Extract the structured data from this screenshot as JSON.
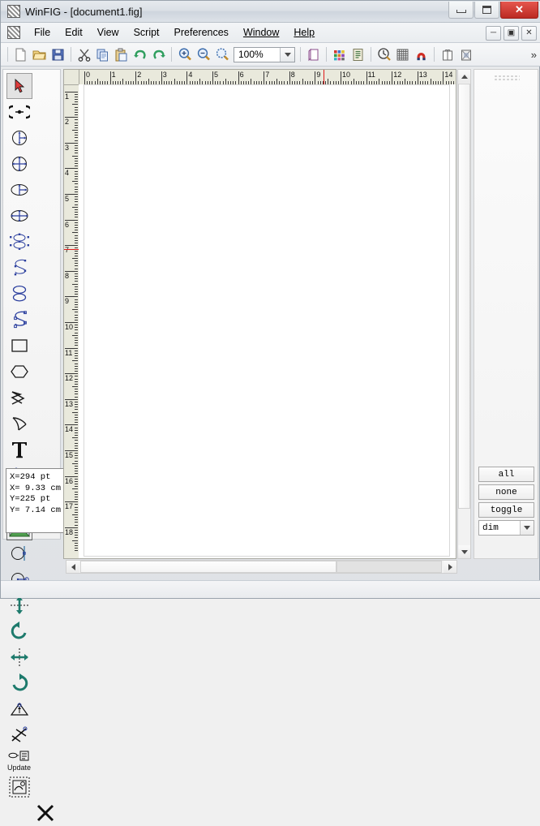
{
  "window": {
    "title": "WinFIG - [document1.fig]",
    "app_icon": "winfig-hatch-icon",
    "buttons": [
      {
        "name": "minimize-button",
        "label": "—"
      },
      {
        "name": "maximize-button",
        "label": "❐"
      },
      {
        "name": "close-button",
        "label": "✕"
      }
    ]
  },
  "menubar": {
    "icon": "document-hatch-icon",
    "items": [
      {
        "label": "File",
        "accel": ""
      },
      {
        "label": "Edit",
        "accel": ""
      },
      {
        "label": "View",
        "accel": ""
      },
      {
        "label": "Script",
        "accel": ""
      },
      {
        "label": "Preferences",
        "accel": ""
      },
      {
        "label": "Window",
        "accel": "W"
      },
      {
        "label": "Help",
        "accel": "H"
      }
    ],
    "mdi_buttons": [
      {
        "name": "mdi-minimize-button",
        "label": "─"
      },
      {
        "name": "mdi-restore-button",
        "label": "▣"
      },
      {
        "name": "mdi-close-button",
        "label": "✕"
      }
    ]
  },
  "toolbar": {
    "zoom_value": "100%",
    "overflow_label": "»",
    "buttons": [
      {
        "name": "new-document-icon",
        "title": "New"
      },
      {
        "name": "open-folder-icon",
        "title": "Open"
      },
      {
        "name": "save-disk-icon",
        "title": "Save"
      },
      {
        "name": "cut-scissors-icon",
        "title": "Cut"
      },
      {
        "name": "copy-icon",
        "title": "Copy"
      },
      {
        "name": "paste-clipboard-icon",
        "title": "Paste"
      },
      {
        "name": "undo-arrow-icon",
        "title": "Undo"
      },
      {
        "name": "redo-arrow-icon",
        "title": "Redo"
      },
      {
        "name": "zoom-in-icon",
        "title": "Zoom In"
      },
      {
        "name": "zoom-out-icon",
        "title": "Zoom Out"
      },
      {
        "name": "zoom-fit-icon",
        "title": "Zoom Fit"
      },
      {
        "name": "page-setup-icon",
        "title": "Page"
      },
      {
        "name": "color-palette-icon",
        "title": "Colors"
      },
      {
        "name": "layers-list-icon",
        "title": "Layers"
      },
      {
        "name": "depth-icon",
        "title": "Depth"
      },
      {
        "name": "grid-icon",
        "title": "Grid"
      },
      {
        "name": "magnet-snap-icon",
        "title": "Snap"
      },
      {
        "name": "library-icon",
        "title": "Library"
      },
      {
        "name": "export-icon",
        "title": "Export"
      }
    ]
  },
  "toolbox": {
    "tools": [
      {
        "name": "tool-select-arrow",
        "selected": true
      },
      {
        "name": "tool-point-edit",
        "selected": false
      },
      {
        "name": "tool-circle-radius",
        "selected": false
      },
      {
        "name": "tool-circle-diameter",
        "selected": false
      },
      {
        "name": "tool-ellipse-radius",
        "selected": false
      },
      {
        "name": "tool-ellipse-diameter",
        "selected": false
      },
      {
        "name": "tool-closed-spline",
        "selected": false
      },
      {
        "name": "tool-open-spline",
        "selected": false
      },
      {
        "name": "tool-closed-interp-spline",
        "selected": false
      },
      {
        "name": "tool-open-interp-spline",
        "selected": false
      },
      {
        "name": "tool-rectangle",
        "selected": false
      },
      {
        "name": "tool-polygon",
        "selected": false
      },
      {
        "name": "tool-polyline",
        "selected": false
      },
      {
        "name": "tool-arc-box",
        "selected": false
      },
      {
        "name": "tool-text",
        "selected": false
      },
      {
        "name": "tool-arc-3point",
        "selected": false
      },
      {
        "name": "tool-arrow-line",
        "selected": false
      },
      {
        "name": "tool-picture",
        "selected": false
      },
      {
        "name": "tool-circle-tangent",
        "selected": false
      },
      {
        "name": "tool-circle-center",
        "selected": false
      },
      {
        "name": "tool-flip-vertical",
        "selected": false
      },
      {
        "name": "tool-rotate-ccw",
        "selected": false
      },
      {
        "name": "tool-flip-horizontal",
        "selected": false
      },
      {
        "name": "tool-rotate-cw",
        "selected": false
      },
      {
        "name": "tool-align-point",
        "selected": false
      },
      {
        "name": "tool-scale-point",
        "selected": false
      },
      {
        "name": "tool-update-properties",
        "selected": false
      },
      {
        "name": "tool-edit-object",
        "selected": false
      },
      {
        "name": "tool-delete",
        "selected": false
      }
    ],
    "update_label": "Update"
  },
  "coordinates": {
    "line1": "X=294 pt",
    "line2": "X= 9.33 cm",
    "line3": "Y=225 pt",
    "line4": "Y= 7.14 cm"
  },
  "rulers": {
    "horizontal_labels": [
      "0",
      "1",
      "2",
      "3",
      "4",
      "5",
      "6",
      "7",
      "8",
      "9",
      "10",
      "11",
      "12",
      "13",
      "14"
    ],
    "vertical_labels": [
      "1",
      "2",
      "3",
      "4",
      "5",
      "6",
      "7",
      "8",
      "9",
      "10",
      "11",
      "12",
      "13",
      "14",
      "15",
      "16",
      "17",
      "18"
    ],
    "unit": "cm",
    "h_marker_value": "9.33",
    "v_marker_value": "7.14"
  },
  "right_panel": {
    "buttons": [
      {
        "name": "select-all-button",
        "label": "all"
      },
      {
        "name": "select-none-button",
        "label": "none"
      },
      {
        "name": "select-toggle-button",
        "label": "toggle"
      }
    ],
    "dropdown": {
      "name": "dim-dropdown",
      "value": "dim"
    }
  },
  "scrollbars": {
    "vertical_up": "▲",
    "vertical_down": "▼",
    "horizontal_left": "◀",
    "horizontal_right": "▶"
  },
  "colors": {
    "title_bar": "#dbe0e6",
    "close_button": "#bb2a22",
    "ruler_bg": "#e9e9dc",
    "canvas": "#ffffff",
    "marker_red": "#e01b1b",
    "tool_blue": "#2b3f9e",
    "tool_green": "#1d7a6c"
  }
}
